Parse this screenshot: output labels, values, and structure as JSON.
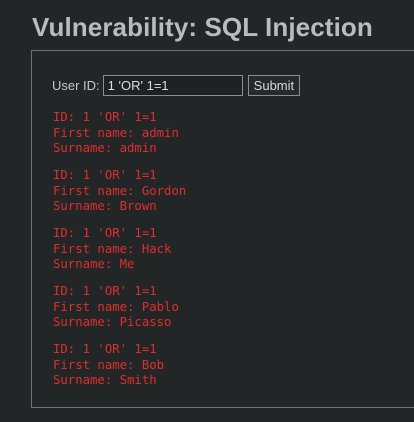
{
  "page": {
    "title": "Vulnerability: SQL Injection"
  },
  "form": {
    "user_id_label": "User ID:",
    "user_id_value": "1 'OR' 1=1",
    "submit_label": "Submit"
  },
  "results": [
    {
      "id_line": "ID: 1 'OR' 1=1",
      "first_name_line": "First name: admin",
      "surname_line": "Surname: admin"
    },
    {
      "id_line": "ID: 1 'OR' 1=1",
      "first_name_line": "First name: Gordon",
      "surname_line": "Surname: Brown"
    },
    {
      "id_line": "ID: 1 'OR' 1=1",
      "first_name_line": "First name: Hack",
      "surname_line": "Surname: Me"
    },
    {
      "id_line": "ID: 1 'OR' 1=1",
      "first_name_line": "First name: Pablo",
      "surname_line": "Surname: Picasso"
    },
    {
      "id_line": "ID: 1 'OR' 1=1",
      "first_name_line": "First name: Bob",
      "surname_line": "Surname: Smith"
    }
  ],
  "colors": {
    "background": "#222626",
    "title_text": "#b9bcbc",
    "result_text": "#e02e2e",
    "box_border": "#6e7370"
  }
}
